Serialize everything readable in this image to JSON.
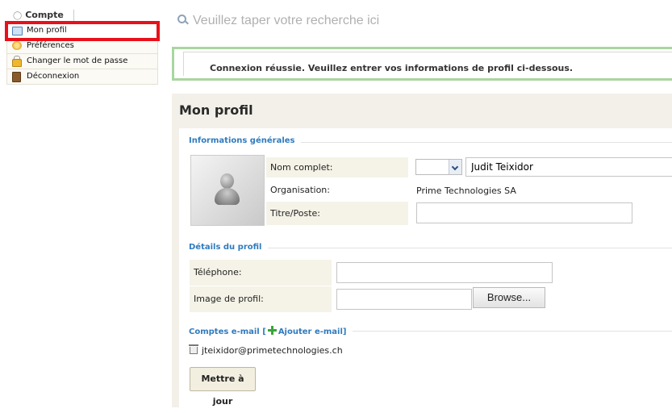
{
  "sidebar": {
    "header": "Compte",
    "header_icon": "person-icon",
    "items": [
      {
        "label": "Mon profil",
        "icon": "profile-card-icon",
        "active": true
      },
      {
        "label": "Préférences",
        "icon": "preferences-icon",
        "active": false
      },
      {
        "label": "Changer le mot de passe",
        "icon": "lock-icon",
        "active": false
      },
      {
        "label": "Déconnexion",
        "icon": "door-icon",
        "active": false
      }
    ]
  },
  "search": {
    "placeholder": "Veuillez taper votre recherche ici"
  },
  "message": {
    "text": "Connexion réussie. Veuillez entrer vos informations de profil ci-dessous.",
    "border_color": "#a9d6a0"
  },
  "profile": {
    "title": "Mon profil",
    "general": {
      "legend": "Informations générales",
      "full_name_label": "Nom complet:",
      "full_name_value": "Judit Teixidor",
      "salutation_value": "",
      "organisation_label": "Organisation:",
      "organisation_value": "Prime Technologies SA",
      "title_label": "Titre/Poste:",
      "title_value": ""
    },
    "details": {
      "legend": "Détails du profil",
      "phone_label": "Téléphone:",
      "phone_value": "",
      "image_label": "Image de profil:",
      "image_value": "",
      "browse_label": "Browse..."
    },
    "emails": {
      "legend": "Comptes e-mail",
      "bracket_open": "[",
      "add_label": "Ajouter e-mail",
      "bracket_close": "]",
      "items": [
        "jteixidor@primetechnologies.ch"
      ]
    },
    "update_label": "Mettre à jour"
  },
  "colors": {
    "accent_blue": "#2f7bbf",
    "label_bg": "#f5f3e7",
    "panel_bg": "#f2f0e8",
    "active_outline": "#e8101a"
  }
}
